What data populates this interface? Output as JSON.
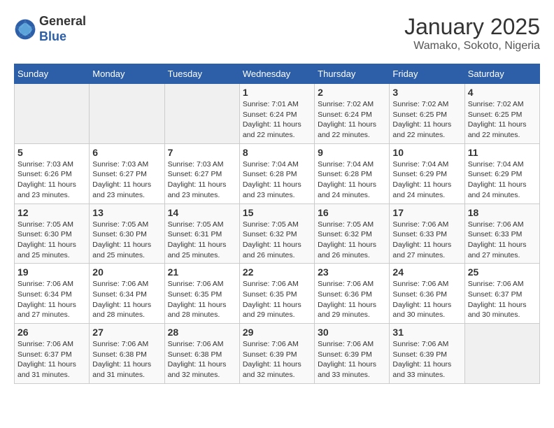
{
  "header": {
    "logo_line1": "General",
    "logo_line2": "Blue",
    "title": "January 2025",
    "subtitle": "Wamako, Sokoto, Nigeria"
  },
  "calendar": {
    "days_of_week": [
      "Sunday",
      "Monday",
      "Tuesday",
      "Wednesday",
      "Thursday",
      "Friday",
      "Saturday"
    ],
    "weeks": [
      [
        {
          "day": "",
          "empty": true
        },
        {
          "day": "",
          "empty": true
        },
        {
          "day": "",
          "empty": true
        },
        {
          "day": "1",
          "sunrise": "7:01 AM",
          "sunset": "6:24 PM",
          "daylight": "11 hours and 22 minutes."
        },
        {
          "day": "2",
          "sunrise": "7:02 AM",
          "sunset": "6:24 PM",
          "daylight": "11 hours and 22 minutes."
        },
        {
          "day": "3",
          "sunrise": "7:02 AM",
          "sunset": "6:25 PM",
          "daylight": "11 hours and 22 minutes."
        },
        {
          "day": "4",
          "sunrise": "7:02 AM",
          "sunset": "6:25 PM",
          "daylight": "11 hours and 22 minutes."
        }
      ],
      [
        {
          "day": "5",
          "sunrise": "7:03 AM",
          "sunset": "6:26 PM",
          "daylight": "11 hours and 23 minutes."
        },
        {
          "day": "6",
          "sunrise": "7:03 AM",
          "sunset": "6:27 PM",
          "daylight": "11 hours and 23 minutes."
        },
        {
          "day": "7",
          "sunrise": "7:03 AM",
          "sunset": "6:27 PM",
          "daylight": "11 hours and 23 minutes."
        },
        {
          "day": "8",
          "sunrise": "7:04 AM",
          "sunset": "6:28 PM",
          "daylight": "11 hours and 23 minutes."
        },
        {
          "day": "9",
          "sunrise": "7:04 AM",
          "sunset": "6:28 PM",
          "daylight": "11 hours and 24 minutes."
        },
        {
          "day": "10",
          "sunrise": "7:04 AM",
          "sunset": "6:29 PM",
          "daylight": "11 hours and 24 minutes."
        },
        {
          "day": "11",
          "sunrise": "7:04 AM",
          "sunset": "6:29 PM",
          "daylight": "11 hours and 24 minutes."
        }
      ],
      [
        {
          "day": "12",
          "sunrise": "7:05 AM",
          "sunset": "6:30 PM",
          "daylight": "11 hours and 25 minutes."
        },
        {
          "day": "13",
          "sunrise": "7:05 AM",
          "sunset": "6:30 PM",
          "daylight": "11 hours and 25 minutes."
        },
        {
          "day": "14",
          "sunrise": "7:05 AM",
          "sunset": "6:31 PM",
          "daylight": "11 hours and 25 minutes."
        },
        {
          "day": "15",
          "sunrise": "7:05 AM",
          "sunset": "6:32 PM",
          "daylight": "11 hours and 26 minutes."
        },
        {
          "day": "16",
          "sunrise": "7:05 AM",
          "sunset": "6:32 PM",
          "daylight": "11 hours and 26 minutes."
        },
        {
          "day": "17",
          "sunrise": "7:06 AM",
          "sunset": "6:33 PM",
          "daylight": "11 hours and 27 minutes."
        },
        {
          "day": "18",
          "sunrise": "7:06 AM",
          "sunset": "6:33 PM",
          "daylight": "11 hours and 27 minutes."
        }
      ],
      [
        {
          "day": "19",
          "sunrise": "7:06 AM",
          "sunset": "6:34 PM",
          "daylight": "11 hours and 27 minutes."
        },
        {
          "day": "20",
          "sunrise": "7:06 AM",
          "sunset": "6:34 PM",
          "daylight": "11 hours and 28 minutes."
        },
        {
          "day": "21",
          "sunrise": "7:06 AM",
          "sunset": "6:35 PM",
          "daylight": "11 hours and 28 minutes."
        },
        {
          "day": "22",
          "sunrise": "7:06 AM",
          "sunset": "6:35 PM",
          "daylight": "11 hours and 29 minutes."
        },
        {
          "day": "23",
          "sunrise": "7:06 AM",
          "sunset": "6:36 PM",
          "daylight": "11 hours and 29 minutes."
        },
        {
          "day": "24",
          "sunrise": "7:06 AM",
          "sunset": "6:36 PM",
          "daylight": "11 hours and 30 minutes."
        },
        {
          "day": "25",
          "sunrise": "7:06 AM",
          "sunset": "6:37 PM",
          "daylight": "11 hours and 30 minutes."
        }
      ],
      [
        {
          "day": "26",
          "sunrise": "7:06 AM",
          "sunset": "6:37 PM",
          "daylight": "11 hours and 31 minutes."
        },
        {
          "day": "27",
          "sunrise": "7:06 AM",
          "sunset": "6:38 PM",
          "daylight": "11 hours and 31 minutes."
        },
        {
          "day": "28",
          "sunrise": "7:06 AM",
          "sunset": "6:38 PM",
          "daylight": "11 hours and 32 minutes."
        },
        {
          "day": "29",
          "sunrise": "7:06 AM",
          "sunset": "6:39 PM",
          "daylight": "11 hours and 32 minutes."
        },
        {
          "day": "30",
          "sunrise": "7:06 AM",
          "sunset": "6:39 PM",
          "daylight": "11 hours and 33 minutes."
        },
        {
          "day": "31",
          "sunrise": "7:06 AM",
          "sunset": "6:39 PM",
          "daylight": "11 hours and 33 minutes."
        },
        {
          "day": "",
          "empty": true
        }
      ]
    ]
  }
}
